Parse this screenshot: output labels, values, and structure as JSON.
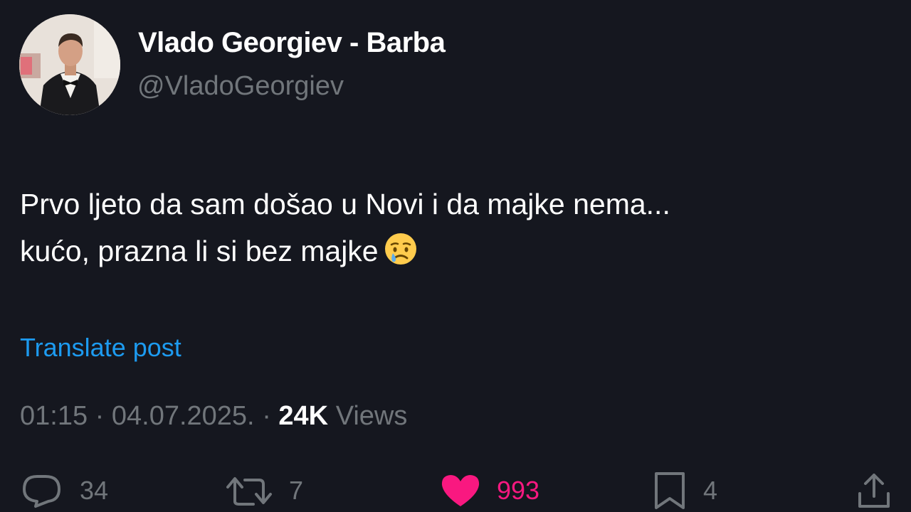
{
  "author": {
    "display_name": "Vlado Georgiev - Barba",
    "handle": "@VladoGeorgiev",
    "avatar_icon": "profile-photo"
  },
  "post": {
    "lines": [
      "Prvo ljeto da sam došao u Novi i da majke nema...",
      "kućo, prazna li si bez majke"
    ],
    "emoji_icon": "crying-face-emoji"
  },
  "translate_label": "Translate post",
  "meta": {
    "time": "01:15",
    "separator": "·",
    "date": "04.07.2025.",
    "views_count": "24K",
    "views_label": "Views"
  },
  "actions": {
    "replies": {
      "icon": "reply-icon",
      "count": "34"
    },
    "reposts": {
      "icon": "repost-icon",
      "count": "7"
    },
    "likes": {
      "icon": "heart-icon",
      "count": "993",
      "active": true
    },
    "bookmarks": {
      "icon": "bookmark-icon",
      "count": "4"
    },
    "share": {
      "icon": "share-icon"
    }
  },
  "colors": {
    "background": "#15171f",
    "text_primary": "#ffffff",
    "text_secondary": "#71767b",
    "link": "#1d9bf0",
    "like": "#f91880"
  }
}
